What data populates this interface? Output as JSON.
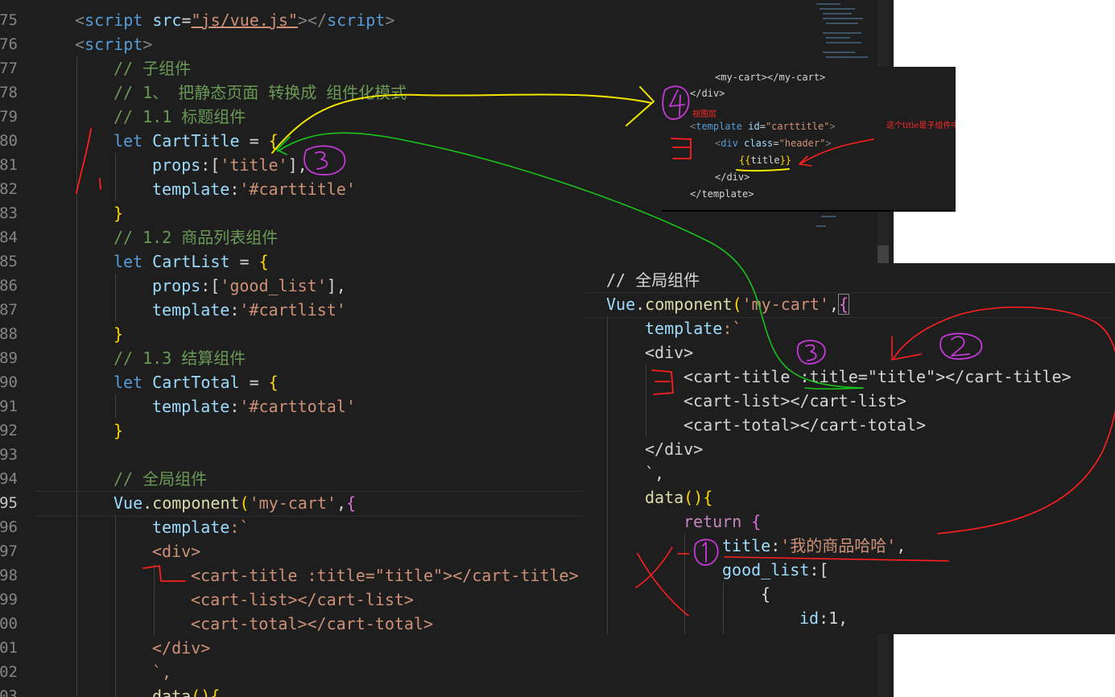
{
  "editor": {
    "line_numbers": [
      "75",
      "76",
      "77",
      "78",
      "79",
      "80",
      "81",
      "82",
      "83",
      "84",
      "85",
      "86",
      "87",
      "88",
      "89",
      "90",
      "91",
      "92",
      "93",
      "94",
      "95",
      "96",
      "97",
      "98",
      "99",
      "00",
      "01",
      "02",
      "03"
    ],
    "active_line": "95",
    "lines": {
      "l75": {
        "p1": "<",
        "p2": "script",
        "p3": " src",
        "p4": "=",
        "p5": "\"js/vue.js\"",
        "p6": "></",
        "p7": "script",
        "p8": ">"
      },
      "l76": {
        "p1": "<",
        "p2": "script",
        "p3": ">"
      },
      "l77": "// 子组件",
      "l78": "// 1、 把静态页面 转换成 组件化模式",
      "l79": "// 1.1 标题组件",
      "l80": {
        "kw": "let",
        "name": " CartTitle",
        "op": " = ",
        "br": "{"
      },
      "l81": {
        "key": "props",
        "p1": ":[",
        "str": "'title'",
        "p2": "],"
      },
      "l82": {
        "key": "template",
        "p1": ":",
        "str": "'#carttitle'"
      },
      "l83": "}",
      "l84": "// 1.2 商品列表组件",
      "l85": {
        "kw": "let",
        "name": " CartList",
        "op": " = ",
        "br": "{"
      },
      "l86": {
        "key": "props",
        "p1": ":[",
        "str": "'good_list'",
        "p2": "],"
      },
      "l87": {
        "key": "template",
        "p1": ":",
        "str": "'#cartlist'"
      },
      "l88": "}",
      "l89": "// 1.3 结算组件",
      "l90": {
        "kw": "let",
        "name": " CartTotal",
        "op": " = ",
        "br": "{"
      },
      "l91": {
        "key": "template",
        "p1": ":",
        "str": "'#carttotal'"
      },
      "l92": "}",
      "l94": "// 全局组件",
      "l95": {
        "obj": "Vue",
        "dot": ".",
        "fn": "component",
        "p1": "(",
        "str": "'my-cart'",
        "p2": ",",
        "br": "{"
      },
      "l96": {
        "key": "template",
        "p1": ":`"
      },
      "l97": "<div>",
      "l98": "<cart-title :title=\"title\"></cart-title>",
      "l99": "<cart-list></cart-list>",
      "l100": "<cart-total></cart-total>",
      "l101": "</div>",
      "l102": "`,",
      "l103": {
        "fn": "data",
        "p1": "(){"
      }
    }
  },
  "snippet_template": {
    "lines": {
      "a": "<my-cart></my-cart>",
      "b": "</div>",
      "c": "视图层",
      "d": {
        "p1": "<",
        "tag": "template",
        "attr": " id",
        "eq": "=",
        "val": "\"carttitle\"",
        "p2": ">"
      },
      "e": {
        "p1": "<",
        "tag": "div",
        "attr": " class",
        "eq": "=",
        "val": "\"header\"",
        "p2": ">"
      },
      "f": {
        "b1": "{{",
        "name": "title",
        "b2": "}}"
      },
      "g": "</div>",
      "h": "</template>"
    },
    "note": "这个title是子组件中pr"
  },
  "snippet_component": {
    "lines": {
      "a": "// 全局组件",
      "b": {
        "obj": "Vue",
        "dot": ".",
        "fn": "component",
        "p1": "(",
        "str": "'my-cart'",
        "p2": ",",
        "br": "{"
      },
      "c": {
        "key": "template",
        "p1": ":`"
      },
      "d": "<div>",
      "e": "<cart-title :title=\"title\"></cart-title>",
      "f": "<cart-list></cart-list>",
      "g": "<cart-total></cart-total>",
      "h": "</div>",
      "i": "`,",
      "j": {
        "fn": "data",
        "p1": "(){"
      },
      "k": {
        "kw": "return",
        "br": " {"
      },
      "l": {
        "key": "title",
        "p1": ":",
        "str": "'我的商品哈哈'",
        "p2": ","
      },
      "m": {
        "key": "good_list",
        "p1": ":["
      },
      "n": "{",
      "o": {
        "key": "id",
        "p1": ":1,"
      }
    }
  },
  "colors": {
    "annotation_red": "#ff1f1f",
    "annotation_yellow": "#f2e600",
    "annotation_green": "#18c418",
    "annotation_purple": "#c43ad6"
  }
}
